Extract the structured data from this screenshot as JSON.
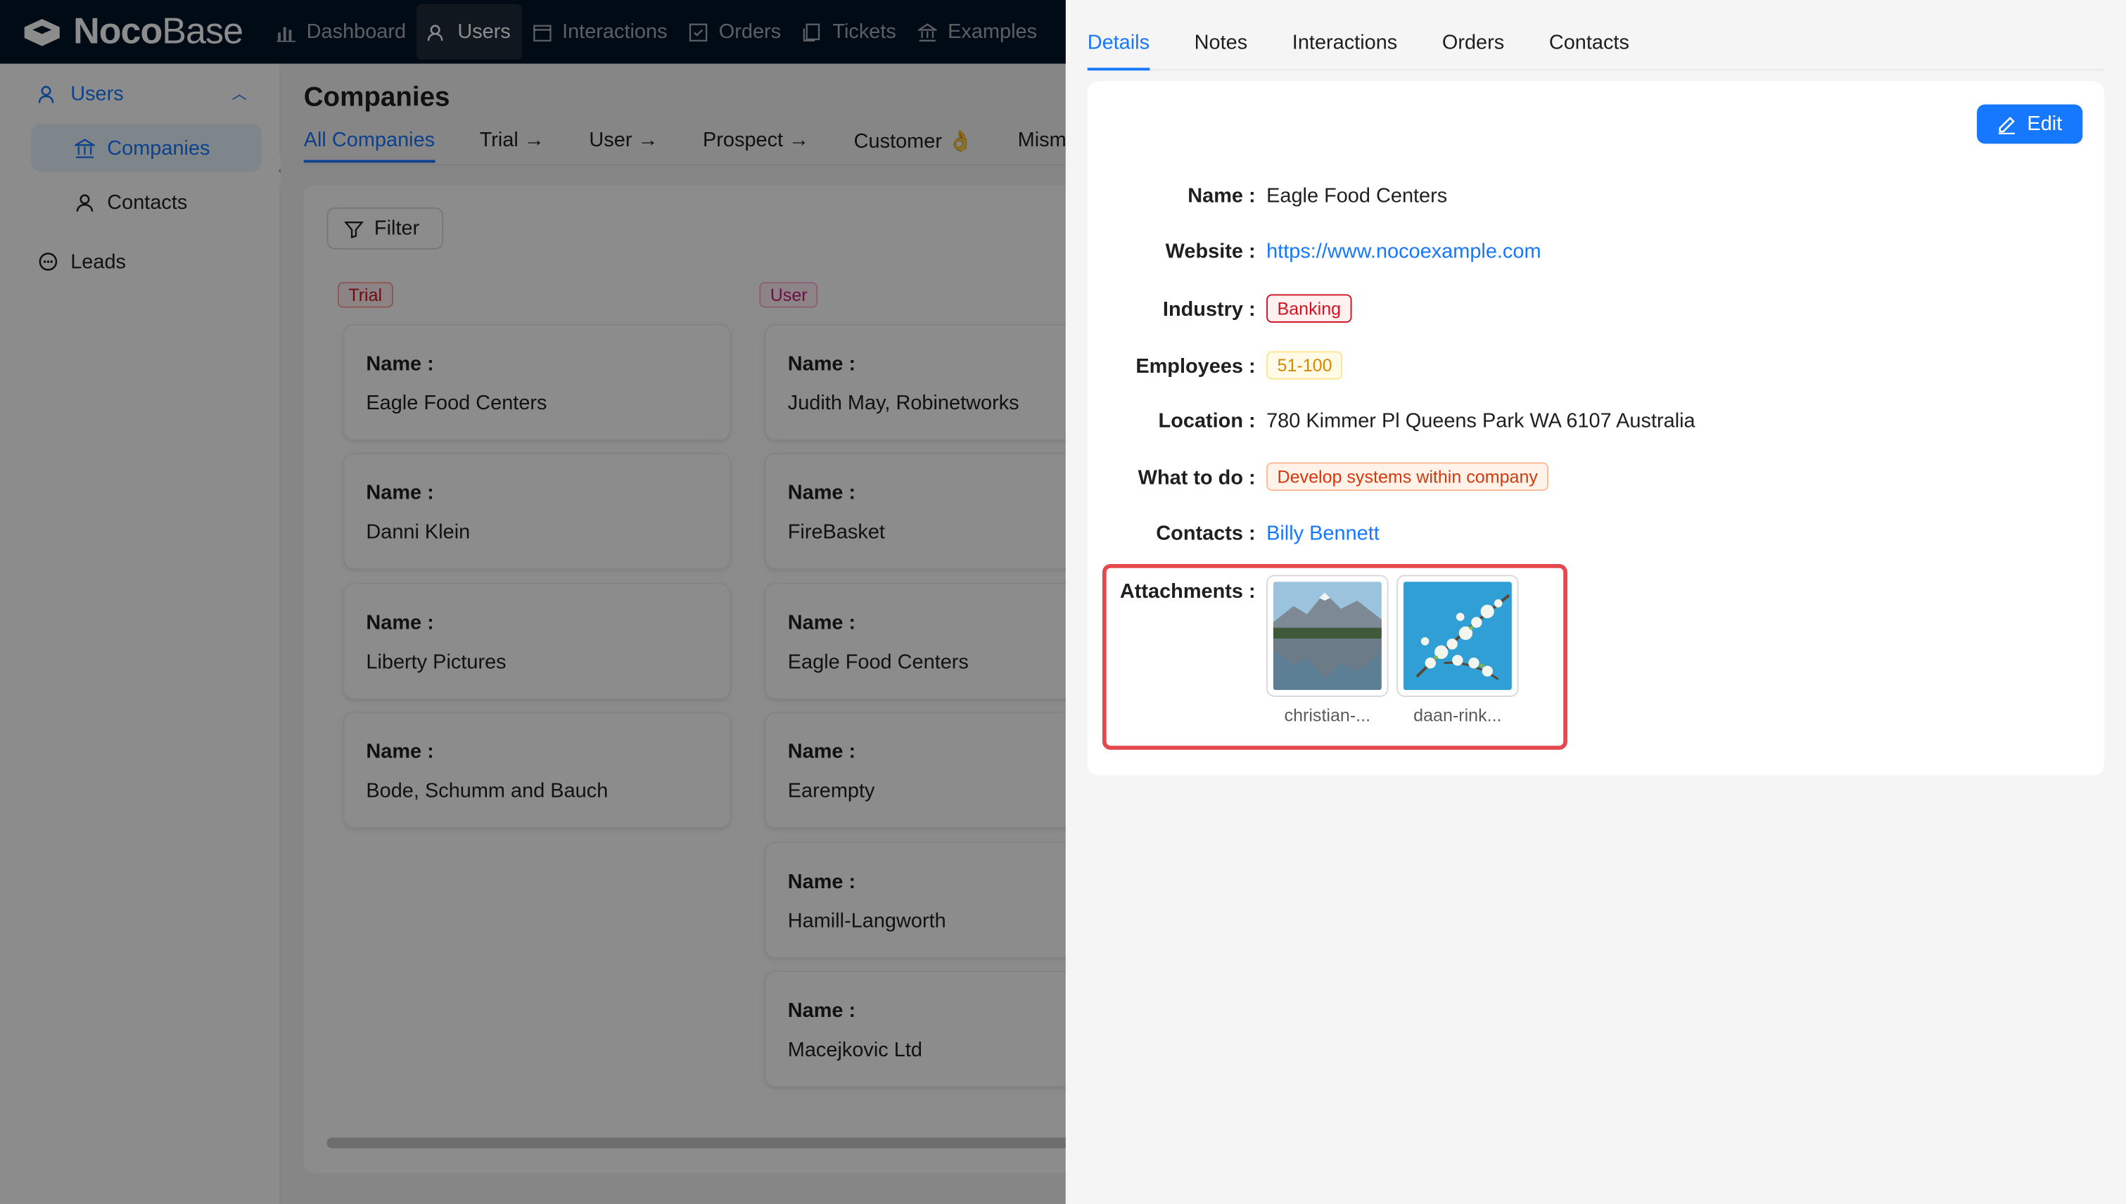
{
  "app": {
    "logo_bold": "Noco",
    "logo_light": "Base"
  },
  "topnav": {
    "items": [
      {
        "label": "Dashboard",
        "icon": "bar-chart-icon"
      },
      {
        "label": "Users",
        "icon": "users-icon"
      },
      {
        "label": "Interactions",
        "icon": "calendar-icon"
      },
      {
        "label": "Orders",
        "icon": "check-square-icon"
      },
      {
        "label": "Tickets",
        "icon": "copy-icon"
      },
      {
        "label": "Examples",
        "icon": "bank-icon"
      }
    ]
  },
  "sidebar": {
    "group_label": "Users",
    "items": [
      {
        "label": "Companies",
        "icon": "bank-icon"
      },
      {
        "label": "Contacts",
        "icon": "user-icon"
      }
    ],
    "leads_label": "Leads"
  },
  "page": {
    "title": "Companies",
    "tabs": [
      "All Companies",
      "Trial →",
      "User →",
      "Prospect →",
      "Customer 👌",
      "Mismat"
    ],
    "filter_label": "Filter",
    "columns": [
      {
        "tag": "Trial",
        "cards": [
          "Eagle Food Centers",
          "Danni Klein",
          "Liberty Pictures",
          "Bode, Schumm and Bauch"
        ]
      },
      {
        "tag": "User",
        "cards": [
          "Judith May, Robinetworks",
          "FireBasket",
          "Eagle Food Centers",
          "Earempty",
          "Hamill-Langworth",
          "Macejkovic Ltd"
        ]
      }
    ],
    "card_label": "Name"
  },
  "drawer": {
    "tabs": [
      "Details",
      "Notes",
      "Interactions",
      "Orders",
      "Contacts"
    ],
    "edit_label": "Edit",
    "fields": {
      "name_label": "Name",
      "name": "Eagle Food Centers",
      "website_label": "Website",
      "website": "https://www.nocoexample.com",
      "industry_label": "Industry",
      "industry": "Banking",
      "employees_label": "Employees",
      "employees": "51-100",
      "location_label": "Location",
      "location": "780 Kimmer Pl Queens Park WA 6107 Australia",
      "todo_label": "What to do",
      "todo": "Develop systems within company",
      "contacts_label": "Contacts",
      "contacts": "Billy Bennett",
      "attachments_label": "Attachments"
    },
    "attachments": [
      "christian-...",
      "daan-rink..."
    ]
  },
  "colors": {
    "primary": "#1677ff",
    "header": "#001529",
    "highlight": "#e5484d"
  }
}
